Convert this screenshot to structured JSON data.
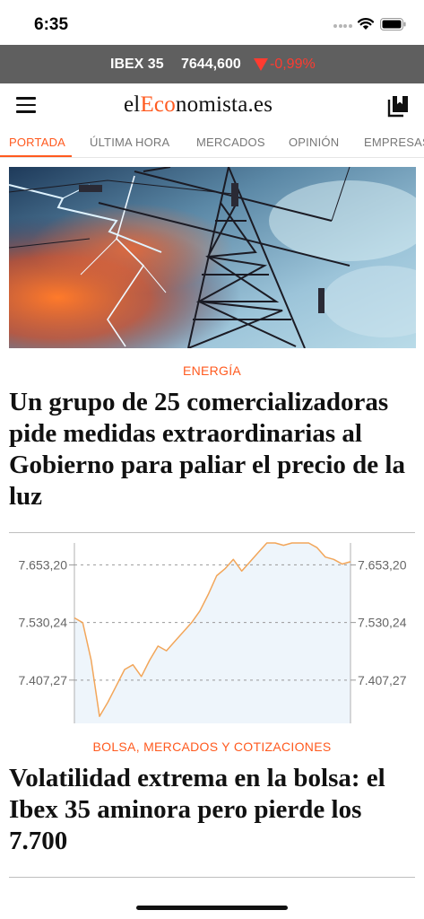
{
  "status_bar": {
    "time": "6:35"
  },
  "ticker": {
    "index_name": "IBEX 35",
    "value": "7644,600",
    "change": "-0,99%",
    "down_color": "#ff3b30"
  },
  "header": {
    "logo_prefix": "el",
    "logo_accent": "Eco",
    "logo_suffix": "nomista.es",
    "accent_color": "#ff5a1f"
  },
  "tabs": [
    {
      "label": "PORTADA",
      "active": true
    },
    {
      "label": "ÚLTIMA HORA",
      "active": false
    },
    {
      "label": "MERCADOS",
      "active": false
    },
    {
      "label": "OPINIÓN",
      "active": false
    },
    {
      "label": "EMPRESAS",
      "active": false
    }
  ],
  "articles": [
    {
      "section": "ENERGÍA",
      "title": "Un grupo de 25 comercializadoras pide medidas extraordinarias al Gobierno para paliar el precio de la luz",
      "image": "electricity-pylon-lightning"
    },
    {
      "section": "BOLSA, MERCADOS Y COTIZACIONES",
      "title": "Volatilidad extrema en la bolsa: el Ibex 35 aminora pero pierde los 7.700",
      "image": "ibex-intraday-chart"
    }
  ],
  "chart_data": {
    "type": "area",
    "title": "",
    "xlabel": "",
    "ylabel": "",
    "y_ticks": [
      "7.653,20",
      "7.530,24",
      "7.407,27"
    ],
    "y_tick_values": [
      7653.2,
      7530.24,
      7407.27
    ],
    "ylim": [
      7315,
      7700
    ],
    "grid": "dashed horizontal",
    "series": [
      {
        "values": [
          7540,
          7530,
          7450,
          7330,
          7360,
          7395,
          7430,
          7440,
          7415,
          7450,
          7480,
          7470,
          7490,
          7510,
          7530,
          7555,
          7590,
          7630,
          7645,
          7665,
          7640,
          7660,
          7680,
          7700,
          7700,
          7695,
          7700,
          7700,
          7700,
          7690,
          7670,
          7665,
          7655,
          7660
        ]
      }
    ],
    "line_color": "#f2a65a",
    "fill_color": "#eef5fb"
  }
}
